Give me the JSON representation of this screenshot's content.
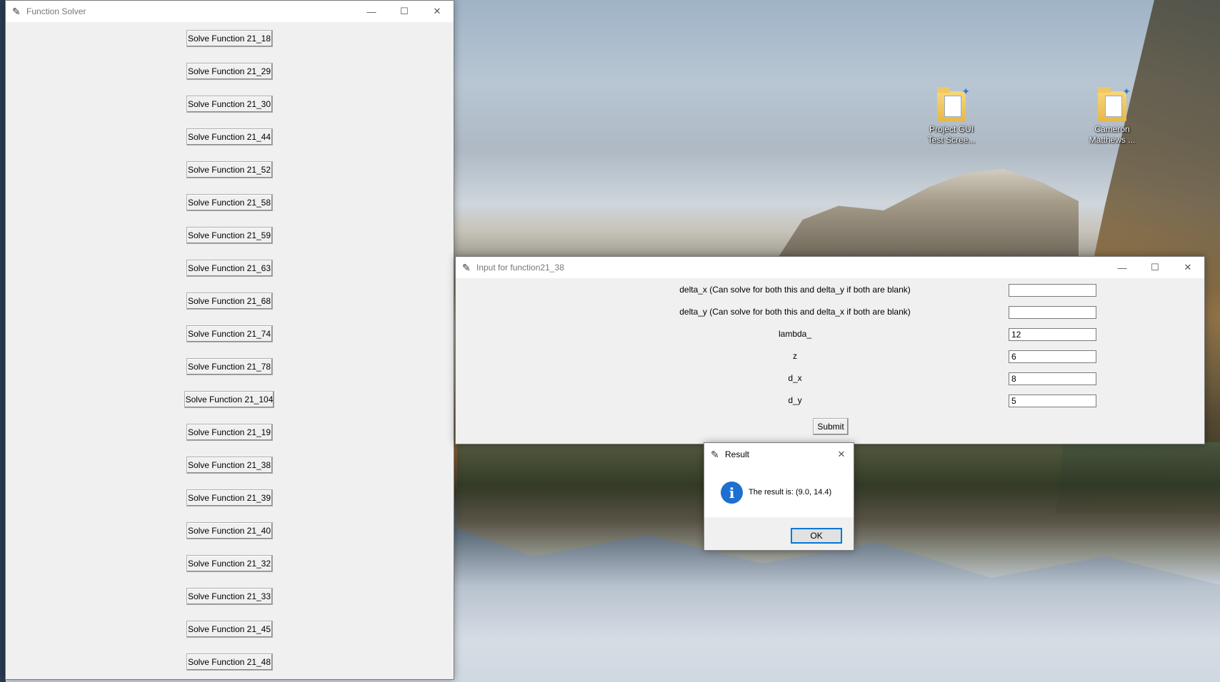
{
  "desktop": {
    "icons": [
      {
        "label_line1": "Project GUI",
        "label_line2": "Test Scree..."
      },
      {
        "label_line1": "Cameron",
        "label_line2": "Matthews ..."
      }
    ]
  },
  "function_solver": {
    "title": "Function Solver",
    "buttons": [
      "Solve Function 21_18",
      "Solve Function 21_29",
      "Solve Function 21_30",
      "Solve Function 21_44",
      "Solve Function 21_52",
      "Solve Function 21_58",
      "Solve Function 21_59",
      "Solve Function 21_63",
      "Solve Function 21_68",
      "Solve Function 21_74",
      "Solve Function 21_78",
      "Solve Function 21_104",
      "Solve Function 21_19",
      "Solve Function 21_38",
      "Solve Function 21_39",
      "Solve Function 21_40",
      "Solve Function 21_32",
      "Solve Function 21_33",
      "Solve Function 21_45",
      "Solve Function 21_48"
    ]
  },
  "input_window": {
    "title": "Input for function21_38",
    "fields": [
      {
        "label": "delta_x (Can solve for both this and delta_y if both are blank)",
        "value": ""
      },
      {
        "label": "delta_y (Can solve for both this and delta_x if both are blank)",
        "value": ""
      },
      {
        "label": "lambda_",
        "value": "12"
      },
      {
        "label": "z",
        "value": "6"
      },
      {
        "label": "d_x",
        "value": "8"
      },
      {
        "label": "d_y",
        "value": "5"
      }
    ],
    "submit_label": "Submit"
  },
  "result_dialog": {
    "title": "Result",
    "message": "The result is: (9.0, 14.4)",
    "ok_label": "OK"
  },
  "window_controls": {
    "minimize": "—",
    "maximize": "☐",
    "close": "✕"
  }
}
